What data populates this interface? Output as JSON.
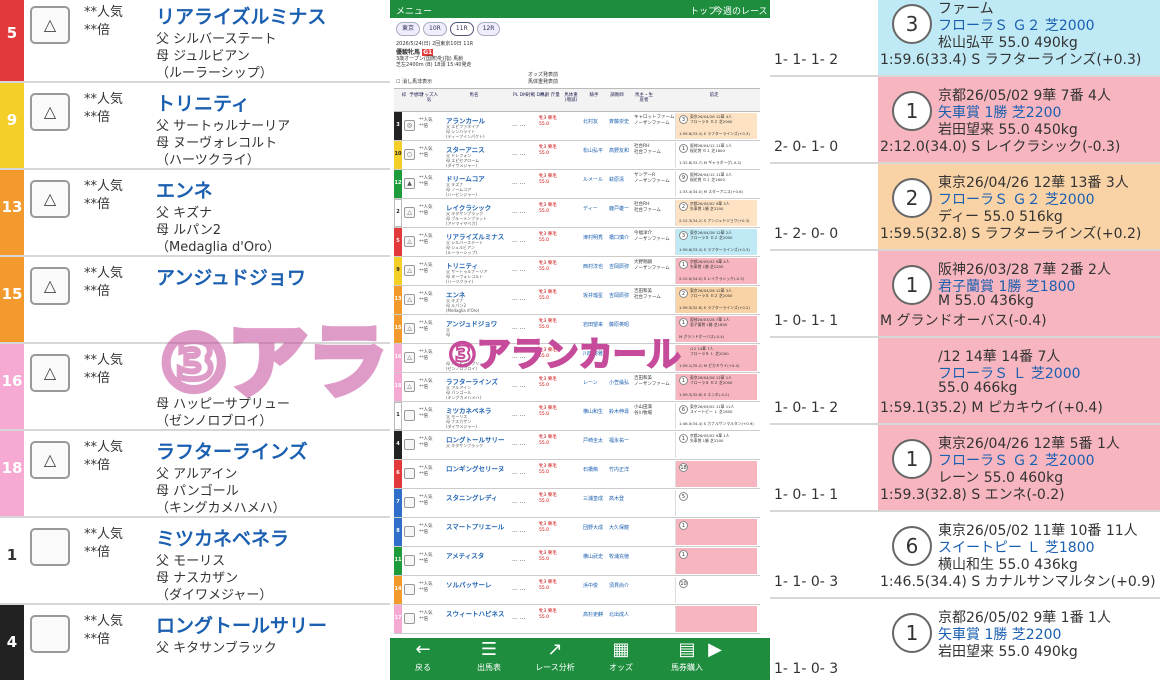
{
  "background_left": {
    "rows": [
      {
        "gate_color": "#e23a3a",
        "num": "5",
        "mark": "△",
        "pop": "**人気",
        "odds": "**倍",
        "name": "リアライズルミナス",
        "line1": "父 シルバーステート",
        "line2": "母 ジュルビアン",
        "line3": "（ルーラーシップ）"
      },
      {
        "gate_color": "#f4cf2a",
        "num": "9",
        "mark": "△",
        "pop": "**人気",
        "odds": "**倍",
        "name": "トリニティ",
        "line1": "父 サートゥルナーリア",
        "line2": "母 ヌーヴォレコルト",
        "line3": "（ハーツクライ）"
      },
      {
        "gate_color": "#f39a2f",
        "num": "13",
        "mark": "△",
        "pop": "**人気",
        "odds": "**倍",
        "name": "エンネ",
        "line1": "父 キズナ",
        "line2": "母 ルパン2",
        "line3": "（Medaglia d'Oro）"
      },
      {
        "gate_color": "#f39a2f",
        "num": "15",
        "mark": "△",
        "pop": "**人気",
        "odds": "**倍",
        "name": "アンジュドジョワ",
        "line1": "",
        "line2": "",
        "line3": ""
      },
      {
        "gate_color": "#f6a9d2",
        "num": "16",
        "mark": "△",
        "pop": "**人気",
        "odds": "**倍",
        "name": "",
        "line1": "",
        "line2": "母 ハッピーサプリュー",
        "line3": "（ゼンノロブロイ）"
      },
      {
        "gate_color": "#f6a9d2",
        "num": "18",
        "mark": "△",
        "pop": "**人気",
        "odds": "**倍",
        "name": "ラフターラインズ",
        "line1": "父 アルアイン",
        "line2": "母 パンゴール",
        "line3": "（キングカメハメハ）"
      },
      {
        "gate_color": "#ffffff",
        "num": "1",
        "mark": "",
        "pop": "**人気",
        "odds": "**倍",
        "name": "ミツカネベネラ",
        "line1": "父 モーリス",
        "line2": "母 ナスカザン",
        "line3": "（ダイワメジャー）"
      },
      {
        "gate_color": "#222222",
        "num": "4",
        "mark": "",
        "pop": "**人気",
        "odds": "**倍",
        "name": "ロングトールサリー",
        "line1": "父 キタサンブラック",
        "line2": "",
        "line3": ""
      }
    ]
  },
  "background_right": {
    "rows": [
      {
        "bg": "#bfe9f4",
        "circle": "3",
        "l1": "ファーム",
        "l2": "フローラＳ Ｇ２ 芝2000",
        "l3": "松山弘平 55.0 490kg",
        "l4": "1:59.6(33.4) S ラフターラインズ(+0.3)",
        "pre": "1-  1-  1-  2"
      },
      {
        "bg": "#f7b6bf",
        "circle": "1",
        "l1": "京都26/05/02 9華 7番 4人",
        "l2": "矢車賞 1勝 芝2200",
        "l3": "岩田望来 55.0 450kg",
        "l4": "2:12.0(34.0) S レイクラシック(-0.3)",
        "pre": "2-  0-  1-  0"
      },
      {
        "bg": "#f9d3a6",
        "circle": "2",
        "l1": "東京26/04/26 12華 13番 3人",
        "l2": "フローラＳ Ｇ２ 芝2000",
        "l3": "ディー 55.0 516kg",
        "l4": "1:59.5(32.8) S ラフターラインズ(+0.2)",
        "pre": "1-  2-  0-  0"
      },
      {
        "bg": "#f7b6bf",
        "circle": "1",
        "l1": "阪神26/03/28 7華 2番 2人",
        "l2": "君子蘭賞 1勝 芝1800",
        "l3": "M 55.0 436kg",
        "l4": "M グランドオーバス(-0.4)",
        "pre": "1-  0-  1-  1"
      },
      {
        "bg": "#f7b6bf",
        "circle": "",
        "l1": "/12 14華 14番 7人",
        "l2": "フローラＳ Ｌ 芝2000",
        "l3": "55.0 466kg",
        "l4": "1:59.1(35.2) M ピカキウイ(+0.4)",
        "pre": "1-  0-  1-  2"
      },
      {
        "bg": "#f7b6bf",
        "circle": "1",
        "l1": "東京26/04/26 12華 5番 1人",
        "l2": "フローラＳ Ｇ２ 芝2000",
        "l3": "レーン 55.0 460kg",
        "l4": "1:59.3(32.8) S エンネ(-0.2)",
        "pre": "1-  0-  1-  1"
      },
      {
        "bg": "#ffffff",
        "circle": "6",
        "l1": "東京26/05/02 11華 10番 11人",
        "l2": "スイートピー Ｌ 芝1800",
        "l3": "横山和生 55.0 436kg",
        "l4": "1:46.5(34.4) S カナルサンマルタン(+0.9)",
        "pre": "1-  1-  0-  3"
      },
      {
        "bg": "#ffffff",
        "circle": "1",
        "l1": "京都26/05/02 9華 1番 1人",
        "l2": "矢車賞 1勝 芝2200",
        "l3": "岩田望来 55.0 490kg",
        "l4": "",
        "pre": "1-  1-  0-  3"
      }
    ]
  },
  "overlay_big": "③アランカール",
  "overlay_small": "③アランカール",
  "phone": {
    "top_menu": "メニュー",
    "top_top": "トップ",
    "top_week": "今週のレース",
    "venue": "東京",
    "race_tabs": [
      "10R",
      "11R",
      "12R"
    ],
    "date_line": "2026/5/24(日) 2回東京10日 11R",
    "race_name": "優駿牝馬",
    "grade": "G1",
    "cond_line": "3歳オープン(国際)牝(指) 馬齢",
    "course_line": "芝左2400m (B) 18頭 15:40発走",
    "odds_note1": "オッズ発表前",
    "odds_note2": "馬体重発表前",
    "checkbox_label": "消し馬非表示",
    "col_headers": [
      "枠",
      "予想印",
      "オッズ人気",
      "馬名",
      "PL DM",
      "対戦 DM",
      "馬齢 斤量",
      "馬体重 (増減)",
      "騎手",
      "調教師",
      "馬主・生産者",
      "前走"
    ],
    "rows": [
      {
        "gate": "#222222",
        "num": "3",
        "mark": "◎",
        "name": "アランカール",
        "sire": "父 エピファネイア",
        "dam": "母 シンハライト",
        "bms": "(ディープインパクト)",
        "jockey": "北村友",
        "trainer": "斉藤崇史",
        "owner1": "キャロットファーム",
        "owner2": "ノーザンファーム",
        "rank": "3",
        "p1": "東京26/04/26 12華 4人",
        "p2": "フローラＳ Ｇ２ 芝2000",
        "p3": "1:59.6(33.4) S ラフターラインズ(+0.3)",
        "pbg": "#fde3c4"
      },
      {
        "gate": "#f4cf2a",
        "num": "10",
        "mark": "○",
        "name": "スターアニス",
        "sire": "父 ドレフォン",
        "dam": "母 エピセアローム",
        "bms": "(ダイワメジャー)",
        "jockey": "松山弘平",
        "trainer": "高野友和",
        "owner1": "社台RH",
        "owner2": "社台ファーム",
        "rank": "1",
        "p1": "阪神26/04/12 11華 1人",
        "p2": "桜花賞 Ｇ１ 芝1600",
        "p3": "1:32.8(33.7) M ギャラボーグ(-0.2)",
        "pbg": "#ffffff"
      },
      {
        "gate": "#1e9b3a",
        "num": "12",
        "mark": "▲",
        "name": "ドリームコア",
        "sire": "父 キズナ",
        "dam": "母 ノームコア",
        "bms": "(ハービンジャー)",
        "jockey": "ルメール",
        "trainer": "萩原清",
        "owner1": "サンデーR",
        "owner2": "ノーザンファーム",
        "rank": "9",
        "p1": "阪神26/04/12 11華 2人",
        "p2": "桜花賞 Ｇ１ 芝1600",
        "p3": "1:33.4(34.0) M スターアニス(+0.6)",
        "pbg": "#ffffff"
      },
      {
        "gate": "#ffffff",
        "num": "2",
        "mark": "△",
        "name": "レイクラシック",
        "sire": "父 キタサンブラック",
        "dam": "母 ブルーメンブラット",
        "bms": "(アドマイヤベガ)",
        "jockey": "ディー",
        "trainer": "鹿戸雄一",
        "owner1": "社台RH",
        "owner2": "社台ファーム",
        "rank": "2",
        "p1": "京都26/05/02 9華 3人",
        "p2": "矢車賞 1勝 芝2200",
        "p3": "2:12.3(34.2) S アンジュドジョワ(+0.3)",
        "pbg": "#fde3c4"
      },
      {
        "gate": "#e23a3a",
        "num": "5",
        "mark": "△",
        "name": "リアライズルミナス",
        "sire": "父 シルバーステート",
        "dam": "母 ジュルビアン",
        "bms": "(ルーラーシップ)",
        "jockey": "津村明秀",
        "trainer": "橋口慎介",
        "owner1": "今福洋介",
        "owner2": "ノーザンファーム",
        "rank": "3",
        "p1": "東京26/04/26 12華 2人",
        "p2": "フローラＳ Ｇ２ 芝2000",
        "p3": "1:59.6(33.4) S ラフターラインズ(+0.3)",
        "pbg": "#bfe9f4"
      },
      {
        "gate": "#f4cf2a",
        "num": "9",
        "mark": "△",
        "name": "トリニティ",
        "sire": "父 サートゥルナーリア",
        "dam": "母 ヌーヴォレコルト",
        "bms": "(ハーツクライ)",
        "jockey": "西村淳也",
        "trainer": "吉岡辰弥",
        "owner1": "大野剛嗣",
        "owner2": "ノーザンファーム",
        "rank": "1",
        "p1": "京都26/05/02 9華 4人",
        "p2": "矢車賞 1勝 芝2200",
        "p3": "2:12.0(34.0) S レイクラシック(-0.3)",
        "pbg": "#f7b6bf"
      },
      {
        "gate": "#f39a2f",
        "num": "13",
        "mark": "△",
        "name": "エンネ",
        "sire": "父 キズナ",
        "dam": "母 ルパン2",
        "bms": "(Medaglia d'Oro)",
        "jockey": "坂井瑠星",
        "trainer": "吉岡辰弥",
        "owner1": "吉田和美",
        "owner2": "社台ファーム",
        "rank": "2",
        "p1": "東京26/04/26 12華 3人",
        "p2": "フローラＳ Ｇ２ 芝2000",
        "p3": "1:59.5(32.8) S ラフターラインズ(+0.2)",
        "pbg": "#f9d3a6"
      },
      {
        "gate": "#f39a2f",
        "num": "15",
        "mark": "△",
        "name": "アンジュドジョワ",
        "sire": "父 ",
        "dam": "母 ",
        "bms": "",
        "jockey": "岩田望来",
        "trainer": "藤原英昭",
        "owner1": "",
        "owner2": "",
        "rank": "1",
        "p1": "阪神26/03/28 7華 2人",
        "p2": "君子蘭賞 1勝 芝1800",
        "p3": "M グランドオーバス(-0.4)",
        "pbg": "#f7b6bf"
      },
      {
        "gate": "#f6a9d2",
        "num": "16",
        "mark": "△",
        "name": "",
        "sire": "",
        "dam": "母 ハッピーサプリュー",
        "bms": "(ゼンノロブロイ)",
        "jockey": "川田将雅",
        "trainer": "",
        "owner1": "",
        "owner2": "",
        "rank": "",
        "p1": "/12 14華 7人",
        "p2": "フローラＳ Ｌ 芝2000",
        "p3": "1:59.1(35.2) M ピカキウイ(+0.4)",
        "pbg": "#f7b6bf"
      },
      {
        "gate": "#f6a9d2",
        "num": "18",
        "mark": "△",
        "name": "ラフターラインズ",
        "sire": "父 アルアイン",
        "dam": "母 パンゴール",
        "bms": "(キングカメハメハ)",
        "jockey": "レーン",
        "trainer": "小笠倫弘",
        "owner1": "吉田和美",
        "owner2": "ノーザンファーム",
        "rank": "1",
        "p1": "東京26/04/26 12華 1人",
        "p2": "フローラＳ Ｇ２ 芝2000",
        "p3": "1:59.3(32.8) S エンネ(-0.2)",
        "pbg": "#f7b6bf"
      },
      {
        "gate": "#ffffff",
        "num": "1",
        "mark": "",
        "name": "ミツカネベネラ",
        "sire": "父 モーリス",
        "dam": "母 ナスカザン",
        "bms": "(ダイワメジャー)",
        "jockey": "横山和生",
        "trainer": "鈴木伸尋",
        "owner1": "小山田満",
        "owner2": "谷川牧場",
        "rank": "6",
        "p1": "東京26/05/02 11華 11人",
        "p2": "スイートピー Ｌ 芝1800",
        "p3": "1:46.5(34.4) S カナルサンマルタン(+0.9)",
        "pbg": "#ffffff"
      },
      {
        "gate": "#222222",
        "num": "4",
        "mark": "",
        "name": "ロングトールサリー",
        "sire": "父 キタサンブラック",
        "dam": "",
        "bms": "",
        "jockey": "戸崎圭太",
        "trainer": "福永祐一",
        "owner1": "",
        "owner2": "",
        "rank": "1",
        "p1": "京都26/05/02 9華 1人",
        "p2": "矢車賞 1勝 芝2200",
        "p3": "",
        "pbg": "#ffffff"
      },
      {
        "gate": "#e23a3a",
        "num": "6",
        "mark": "",
        "name": "ロンギングセリーヌ",
        "sire": "",
        "dam": "",
        "bms": "",
        "jockey": "石橋脩",
        "trainer": "竹内正洋",
        "owner1": "",
        "owner2": "",
        "rank": "18",
        "p1": "",
        "p2": "",
        "p3": "",
        "pbg": "#f7b6bf"
      },
      {
        "gate": "#2f6fc9",
        "num": "7",
        "mark": "",
        "name": "スタニングレディ",
        "sire": "",
        "dam": "",
        "bms": "",
        "jockey": "三浦皇成",
        "trainer": "高木登",
        "owner1": "",
        "owner2": "",
        "rank": "5",
        "p1": "",
        "p2": "",
        "p3": "",
        "pbg": "#ffffff"
      },
      {
        "gate": "#2f6fc9",
        "num": "8",
        "mark": "",
        "name": "スマートプリエール",
        "sire": "",
        "dam": "",
        "bms": "",
        "jockey": "団野大成",
        "trainer": "大久保龍",
        "owner1": "",
        "owner2": "",
        "rank": "1",
        "p1": "",
        "p2": "",
        "p3": "",
        "pbg": "#f7b6bf"
      },
      {
        "gate": "#1e9b3a",
        "num": "11",
        "mark": "",
        "name": "アメティスタ",
        "sire": "",
        "dam": "",
        "bms": "",
        "jockey": "横山武史",
        "trainer": "牧浦充徳",
        "owner1": "",
        "owner2": "",
        "rank": "1",
        "p1": "",
        "p2": "",
        "p3": "",
        "pbg": "#f7b6bf"
      },
      {
        "gate": "#f39a2f",
        "num": "14",
        "mark": "",
        "name": "ソルパッサーレ",
        "sire": "",
        "dam": "",
        "bms": "",
        "jockey": "浜中俊",
        "trainer": "須貝尚介",
        "owner1": "",
        "owner2": "",
        "rank": "10",
        "p1": "",
        "p2": "",
        "p3": "",
        "pbg": "#ffffff"
      },
      {
        "gate": "#f6a9d2",
        "num": "17",
        "mark": "",
        "name": "スウィートハピネス",
        "sire": "",
        "dam": "",
        "bms": "",
        "jockey": "高杉吏麒",
        "trainer": "北出成人",
        "owner1": "",
        "owner2": "",
        "rank": "",
        "p1": "",
        "p2": "",
        "p3": "",
        "pbg": "#f7b6bf"
      }
    ],
    "bottom_nav": [
      {
        "icon": "←",
        "label": "戻る"
      },
      {
        "icon": "☰",
        "label": "出馬表"
      },
      {
        "icon": "↗",
        "label": "レース分析"
      },
      {
        "icon": "▦",
        "label": "オッズ"
      },
      {
        "icon": "▤",
        "label": "馬券購入"
      },
      {
        "icon": "▶",
        "label": ""
      }
    ]
  }
}
